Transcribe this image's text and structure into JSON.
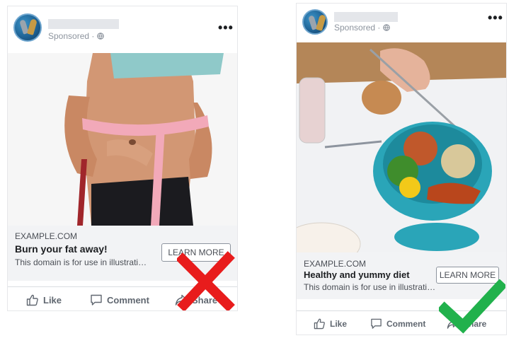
{
  "cards": [
    {
      "sponsored": "Sponsored · ",
      "more_icon": "•••",
      "domain": "EXAMPLE.COM",
      "headline": "Burn your fat away!",
      "description": "This domain is for use in illustrati…",
      "cta": "LEARN MORE",
      "actions": {
        "like": "Like",
        "comment": "Comment",
        "share": "Share"
      },
      "verdict_icon": "red-x-icon"
    },
    {
      "sponsored": "Sponsored · ",
      "more_icon": "•••",
      "domain": "EXAMPLE.COM",
      "headline": "Healthy and yummy diet",
      "description": "This domain is for use in illustrati…",
      "cta": "LEARN MORE",
      "actions": {
        "like": "Like",
        "comment": "Comment",
        "share": "Share"
      },
      "verdict_icon": "green-check-icon"
    }
  ],
  "colors": {
    "reject": "#e81c1c",
    "approve": "#21b14c",
    "strip": "#f2f3f5"
  }
}
